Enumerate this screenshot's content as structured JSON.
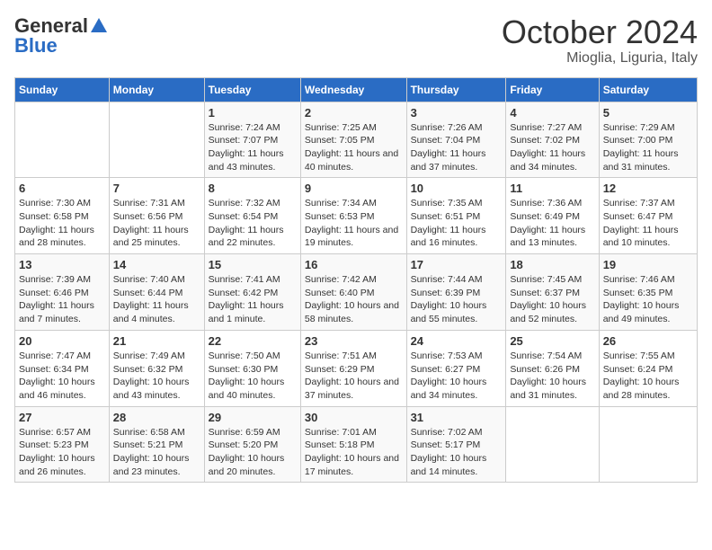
{
  "header": {
    "logo_general": "General",
    "logo_blue": "Blue",
    "month": "October 2024",
    "location": "Mioglia, Liguria, Italy"
  },
  "weekdays": [
    "Sunday",
    "Monday",
    "Tuesday",
    "Wednesday",
    "Thursday",
    "Friday",
    "Saturday"
  ],
  "weeks": [
    [
      {
        "day": "",
        "sunrise": "",
        "sunset": "",
        "daylight": ""
      },
      {
        "day": "",
        "sunrise": "",
        "sunset": "",
        "daylight": ""
      },
      {
        "day": "1",
        "sunrise": "Sunrise: 7:24 AM",
        "sunset": "Sunset: 7:07 PM",
        "daylight": "Daylight: 11 hours and 43 minutes."
      },
      {
        "day": "2",
        "sunrise": "Sunrise: 7:25 AM",
        "sunset": "Sunset: 7:05 PM",
        "daylight": "Daylight: 11 hours and 40 minutes."
      },
      {
        "day": "3",
        "sunrise": "Sunrise: 7:26 AM",
        "sunset": "Sunset: 7:04 PM",
        "daylight": "Daylight: 11 hours and 37 minutes."
      },
      {
        "day": "4",
        "sunrise": "Sunrise: 7:27 AM",
        "sunset": "Sunset: 7:02 PM",
        "daylight": "Daylight: 11 hours and 34 minutes."
      },
      {
        "day": "5",
        "sunrise": "Sunrise: 7:29 AM",
        "sunset": "Sunset: 7:00 PM",
        "daylight": "Daylight: 11 hours and 31 minutes."
      }
    ],
    [
      {
        "day": "6",
        "sunrise": "Sunrise: 7:30 AM",
        "sunset": "Sunset: 6:58 PM",
        "daylight": "Daylight: 11 hours and 28 minutes."
      },
      {
        "day": "7",
        "sunrise": "Sunrise: 7:31 AM",
        "sunset": "Sunset: 6:56 PM",
        "daylight": "Daylight: 11 hours and 25 minutes."
      },
      {
        "day": "8",
        "sunrise": "Sunrise: 7:32 AM",
        "sunset": "Sunset: 6:54 PM",
        "daylight": "Daylight: 11 hours and 22 minutes."
      },
      {
        "day": "9",
        "sunrise": "Sunrise: 7:34 AM",
        "sunset": "Sunset: 6:53 PM",
        "daylight": "Daylight: 11 hours and 19 minutes."
      },
      {
        "day": "10",
        "sunrise": "Sunrise: 7:35 AM",
        "sunset": "Sunset: 6:51 PM",
        "daylight": "Daylight: 11 hours and 16 minutes."
      },
      {
        "day": "11",
        "sunrise": "Sunrise: 7:36 AM",
        "sunset": "Sunset: 6:49 PM",
        "daylight": "Daylight: 11 hours and 13 minutes."
      },
      {
        "day": "12",
        "sunrise": "Sunrise: 7:37 AM",
        "sunset": "Sunset: 6:47 PM",
        "daylight": "Daylight: 11 hours and 10 minutes."
      }
    ],
    [
      {
        "day": "13",
        "sunrise": "Sunrise: 7:39 AM",
        "sunset": "Sunset: 6:46 PM",
        "daylight": "Daylight: 11 hours and 7 minutes."
      },
      {
        "day": "14",
        "sunrise": "Sunrise: 7:40 AM",
        "sunset": "Sunset: 6:44 PM",
        "daylight": "Daylight: 11 hours and 4 minutes."
      },
      {
        "day": "15",
        "sunrise": "Sunrise: 7:41 AM",
        "sunset": "Sunset: 6:42 PM",
        "daylight": "Daylight: 11 hours and 1 minute."
      },
      {
        "day": "16",
        "sunrise": "Sunrise: 7:42 AM",
        "sunset": "Sunset: 6:40 PM",
        "daylight": "Daylight: 10 hours and 58 minutes."
      },
      {
        "day": "17",
        "sunrise": "Sunrise: 7:44 AM",
        "sunset": "Sunset: 6:39 PM",
        "daylight": "Daylight: 10 hours and 55 minutes."
      },
      {
        "day": "18",
        "sunrise": "Sunrise: 7:45 AM",
        "sunset": "Sunset: 6:37 PM",
        "daylight": "Daylight: 10 hours and 52 minutes."
      },
      {
        "day": "19",
        "sunrise": "Sunrise: 7:46 AM",
        "sunset": "Sunset: 6:35 PM",
        "daylight": "Daylight: 10 hours and 49 minutes."
      }
    ],
    [
      {
        "day": "20",
        "sunrise": "Sunrise: 7:47 AM",
        "sunset": "Sunset: 6:34 PM",
        "daylight": "Daylight: 10 hours and 46 minutes."
      },
      {
        "day": "21",
        "sunrise": "Sunrise: 7:49 AM",
        "sunset": "Sunset: 6:32 PM",
        "daylight": "Daylight: 10 hours and 43 minutes."
      },
      {
        "day": "22",
        "sunrise": "Sunrise: 7:50 AM",
        "sunset": "Sunset: 6:30 PM",
        "daylight": "Daylight: 10 hours and 40 minutes."
      },
      {
        "day": "23",
        "sunrise": "Sunrise: 7:51 AM",
        "sunset": "Sunset: 6:29 PM",
        "daylight": "Daylight: 10 hours and 37 minutes."
      },
      {
        "day": "24",
        "sunrise": "Sunrise: 7:53 AM",
        "sunset": "Sunset: 6:27 PM",
        "daylight": "Daylight: 10 hours and 34 minutes."
      },
      {
        "day": "25",
        "sunrise": "Sunrise: 7:54 AM",
        "sunset": "Sunset: 6:26 PM",
        "daylight": "Daylight: 10 hours and 31 minutes."
      },
      {
        "day": "26",
        "sunrise": "Sunrise: 7:55 AM",
        "sunset": "Sunset: 6:24 PM",
        "daylight": "Daylight: 10 hours and 28 minutes."
      }
    ],
    [
      {
        "day": "27",
        "sunrise": "Sunrise: 6:57 AM",
        "sunset": "Sunset: 5:23 PM",
        "daylight": "Daylight: 10 hours and 26 minutes."
      },
      {
        "day": "28",
        "sunrise": "Sunrise: 6:58 AM",
        "sunset": "Sunset: 5:21 PM",
        "daylight": "Daylight: 10 hours and 23 minutes."
      },
      {
        "day": "29",
        "sunrise": "Sunrise: 6:59 AM",
        "sunset": "Sunset: 5:20 PM",
        "daylight": "Daylight: 10 hours and 20 minutes."
      },
      {
        "day": "30",
        "sunrise": "Sunrise: 7:01 AM",
        "sunset": "Sunset: 5:18 PM",
        "daylight": "Daylight: 10 hours and 17 minutes."
      },
      {
        "day": "31",
        "sunrise": "Sunrise: 7:02 AM",
        "sunset": "Sunset: 5:17 PM",
        "daylight": "Daylight: 10 hours and 14 minutes."
      },
      {
        "day": "",
        "sunrise": "",
        "sunset": "",
        "daylight": ""
      },
      {
        "day": "",
        "sunrise": "",
        "sunset": "",
        "daylight": ""
      }
    ]
  ]
}
